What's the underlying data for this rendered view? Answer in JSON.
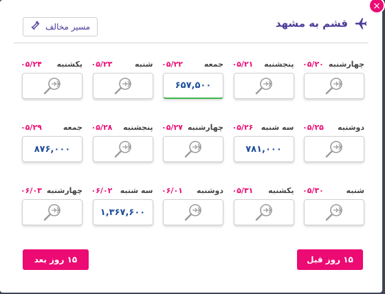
{
  "header": {
    "route_title": "قشم به مشهد",
    "opposite_label": "مسیر مخالف"
  },
  "close_label": "×",
  "rows": [
    [
      {
        "day": "چهارشنبه",
        "date": "۰۵/۲۰",
        "price": ""
      },
      {
        "day": "پنجشنبه",
        "date": "۰۵/۲۱",
        "price": ""
      },
      {
        "day": "جمعه",
        "date": "۰۵/۲۲",
        "price": "۶۵۷,۵۰۰",
        "selected": true
      },
      {
        "day": "شنبه",
        "date": "۰۵/۲۳",
        "price": ""
      },
      {
        "day": "یکشنبه",
        "date": "۰۵/۲۴",
        "price": ""
      }
    ],
    [
      {
        "day": "دوشنبه",
        "date": "۰۵/۲۵",
        "price": ""
      },
      {
        "day": "سه شنبه",
        "date": "۰۵/۲۶",
        "price": "۷۸۱,۰۰۰"
      },
      {
        "day": "چهارشنبه",
        "date": "۰۵/۲۷",
        "price": ""
      },
      {
        "day": "پنجشنبه",
        "date": "۰۵/۲۸",
        "price": ""
      },
      {
        "day": "جمعه",
        "date": "۰۵/۲۹",
        "price": "۸۷۶,۰۰۰"
      }
    ],
    [
      {
        "day": "شنبه",
        "date": "۰۵/۳۰",
        "price": ""
      },
      {
        "day": "یکشنبه",
        "date": "۰۵/۳۱",
        "price": ""
      },
      {
        "day": "دوشنبه",
        "date": "۰۶/۰۱",
        "price": ""
      },
      {
        "day": "سه شنبه",
        "date": "۰۶/۰۲",
        "price": "۱,۳۶۷,۶۰۰"
      },
      {
        "day": "چهارشنبه",
        "date": "۰۶/۰۳",
        "price": ""
      }
    ]
  ],
  "nav": {
    "prev_label": "۱۵ روز قبل",
    "next_label": "۱۵ روز بعد"
  },
  "colors": {
    "accent": "#ec0a73",
    "title": "#4a3a9a",
    "price": "#1f4f9a",
    "selected_bar": "#3db54a"
  }
}
